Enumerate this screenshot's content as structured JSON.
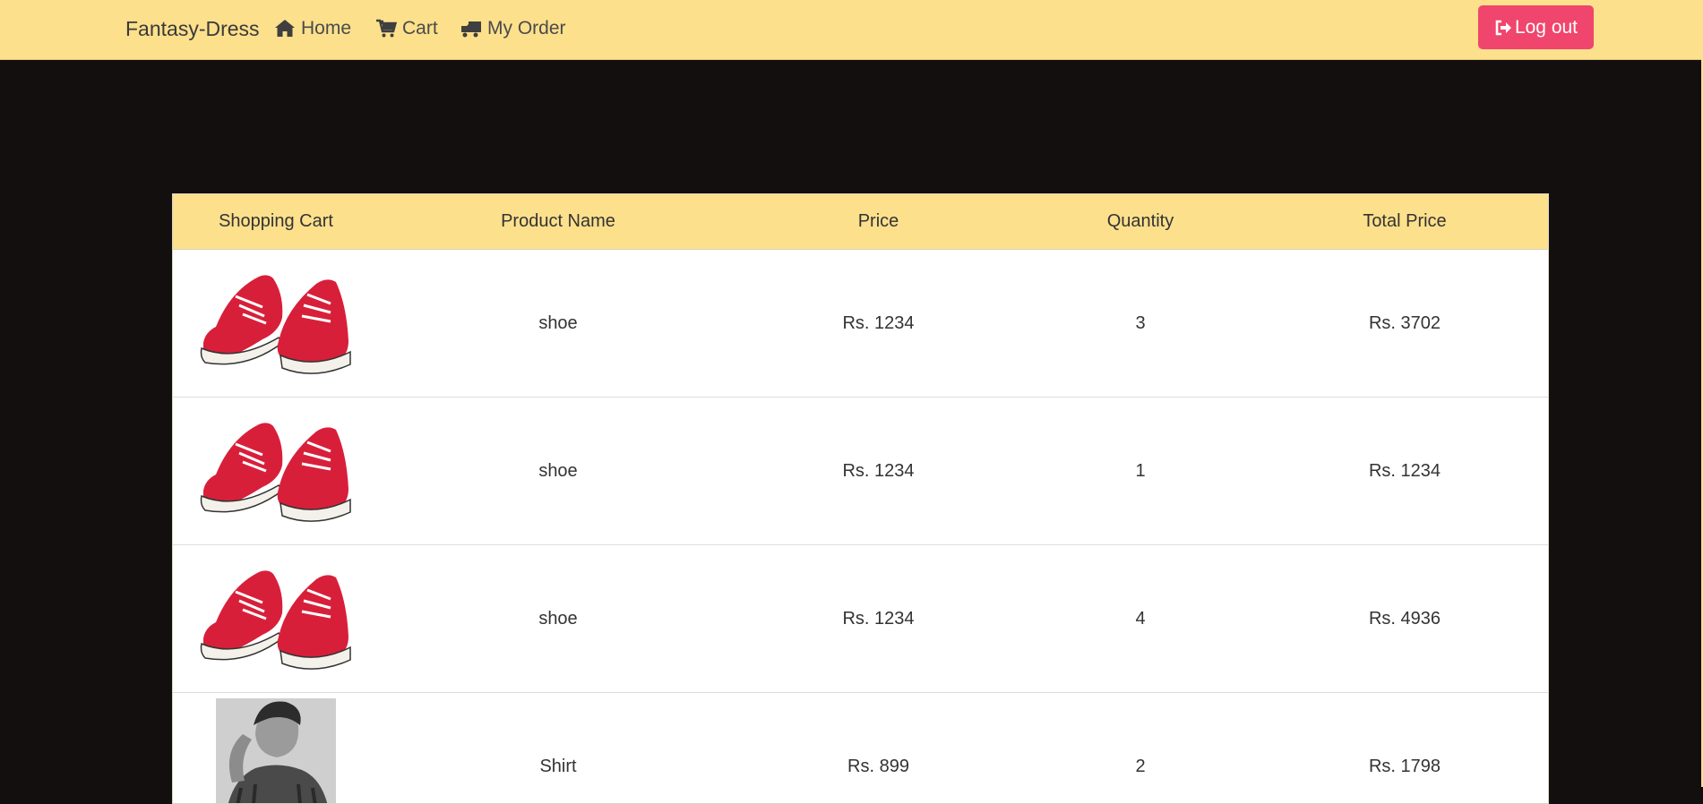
{
  "nav": {
    "brand": "Fantasy-Dress",
    "links": [
      {
        "label": "Home",
        "icon": "home-icon"
      },
      {
        "label": "Cart",
        "icon": "cart-icon"
      },
      {
        "label": "My Order",
        "icon": "truck-icon"
      }
    ],
    "logout": {
      "label": "Log out",
      "icon": "sign-out-icon"
    }
  },
  "cart": {
    "columns": [
      "Shopping Cart",
      "Product Name",
      "Price",
      "Quantity",
      "Total Price"
    ],
    "rows": [
      {
        "name": "shoe",
        "price": "Rs. 1234",
        "quantity": "3",
        "total": "Rs. 3702",
        "image": "red-sneakers-image"
      },
      {
        "name": "shoe",
        "price": "Rs. 1234",
        "quantity": "1",
        "total": "Rs. 1234",
        "image": "red-sneakers-image"
      },
      {
        "name": "shoe",
        "price": "Rs. 1234",
        "quantity": "4",
        "total": "Rs. 4936",
        "image": "red-sneakers-image"
      },
      {
        "name": "Shirt",
        "price": "Rs. 899",
        "quantity": "2",
        "total": "Rs. 1798",
        "image": "man-in-shirt-photo"
      }
    ]
  },
  "colors": {
    "navbar": "#fde08c",
    "page_bg": "#140f0f",
    "logout_button": "#f0456c",
    "sneaker_red": "#d81f3a"
  }
}
